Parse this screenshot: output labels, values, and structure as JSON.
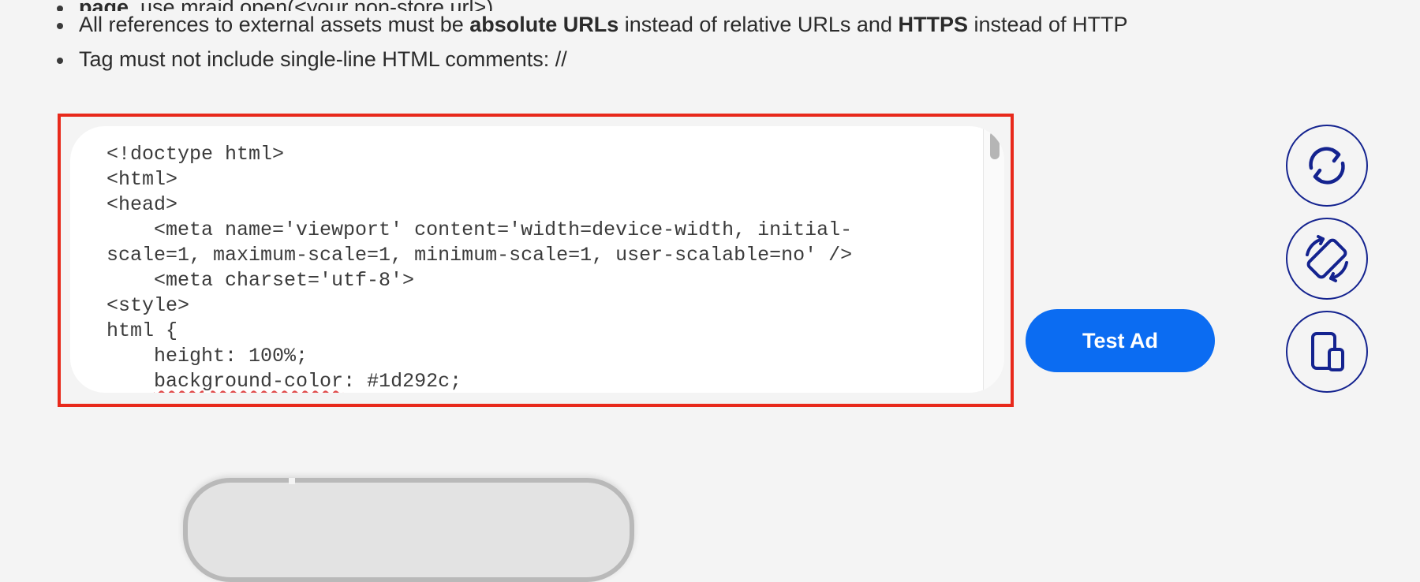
{
  "instructions": {
    "cut_line": [
      {
        "text": "page",
        "bold": true
      },
      {
        "text": ", use mraid.open(<your non-store url>)",
        "bold": false
      }
    ],
    "line1": [
      {
        "text": "All references to external assets must be ",
        "bold": false
      },
      {
        "text": "absolute URLs",
        "bold": true
      },
      {
        "text": " instead of relative URLs and ",
        "bold": false
      },
      {
        "text": "HTTPS",
        "bold": true
      },
      {
        "text": " instead of HTTP",
        "bold": false
      }
    ],
    "line2": [
      {
        "text": "Tag must not include single-line HTML comments: //",
        "bold": false
      }
    ]
  },
  "editor": {
    "lines": [
      "<!doctype html>",
      "<html>",
      "<head>",
      "    <meta name='viewport' content='width=device-width, initial-",
      "scale=1, maximum-scale=1, minimum-scale=1, user-scalable=no' />",
      "    <meta charset='utf-8'>",
      "<style>",
      "html {",
      "    height: 100%;",
      "    background-color: #1d292c;"
    ],
    "highlight_color": "#e8291b"
  },
  "actions": {
    "test_ad_label": "Test Ad",
    "refresh_icon": "refresh-icon",
    "rotate_icon": "rotate-device-icon",
    "device_size_icon": "device-size-icon"
  },
  "colors": {
    "accent": "#0b6cf2",
    "icon_stroke": "#14238f",
    "frame": "#e8291b"
  }
}
